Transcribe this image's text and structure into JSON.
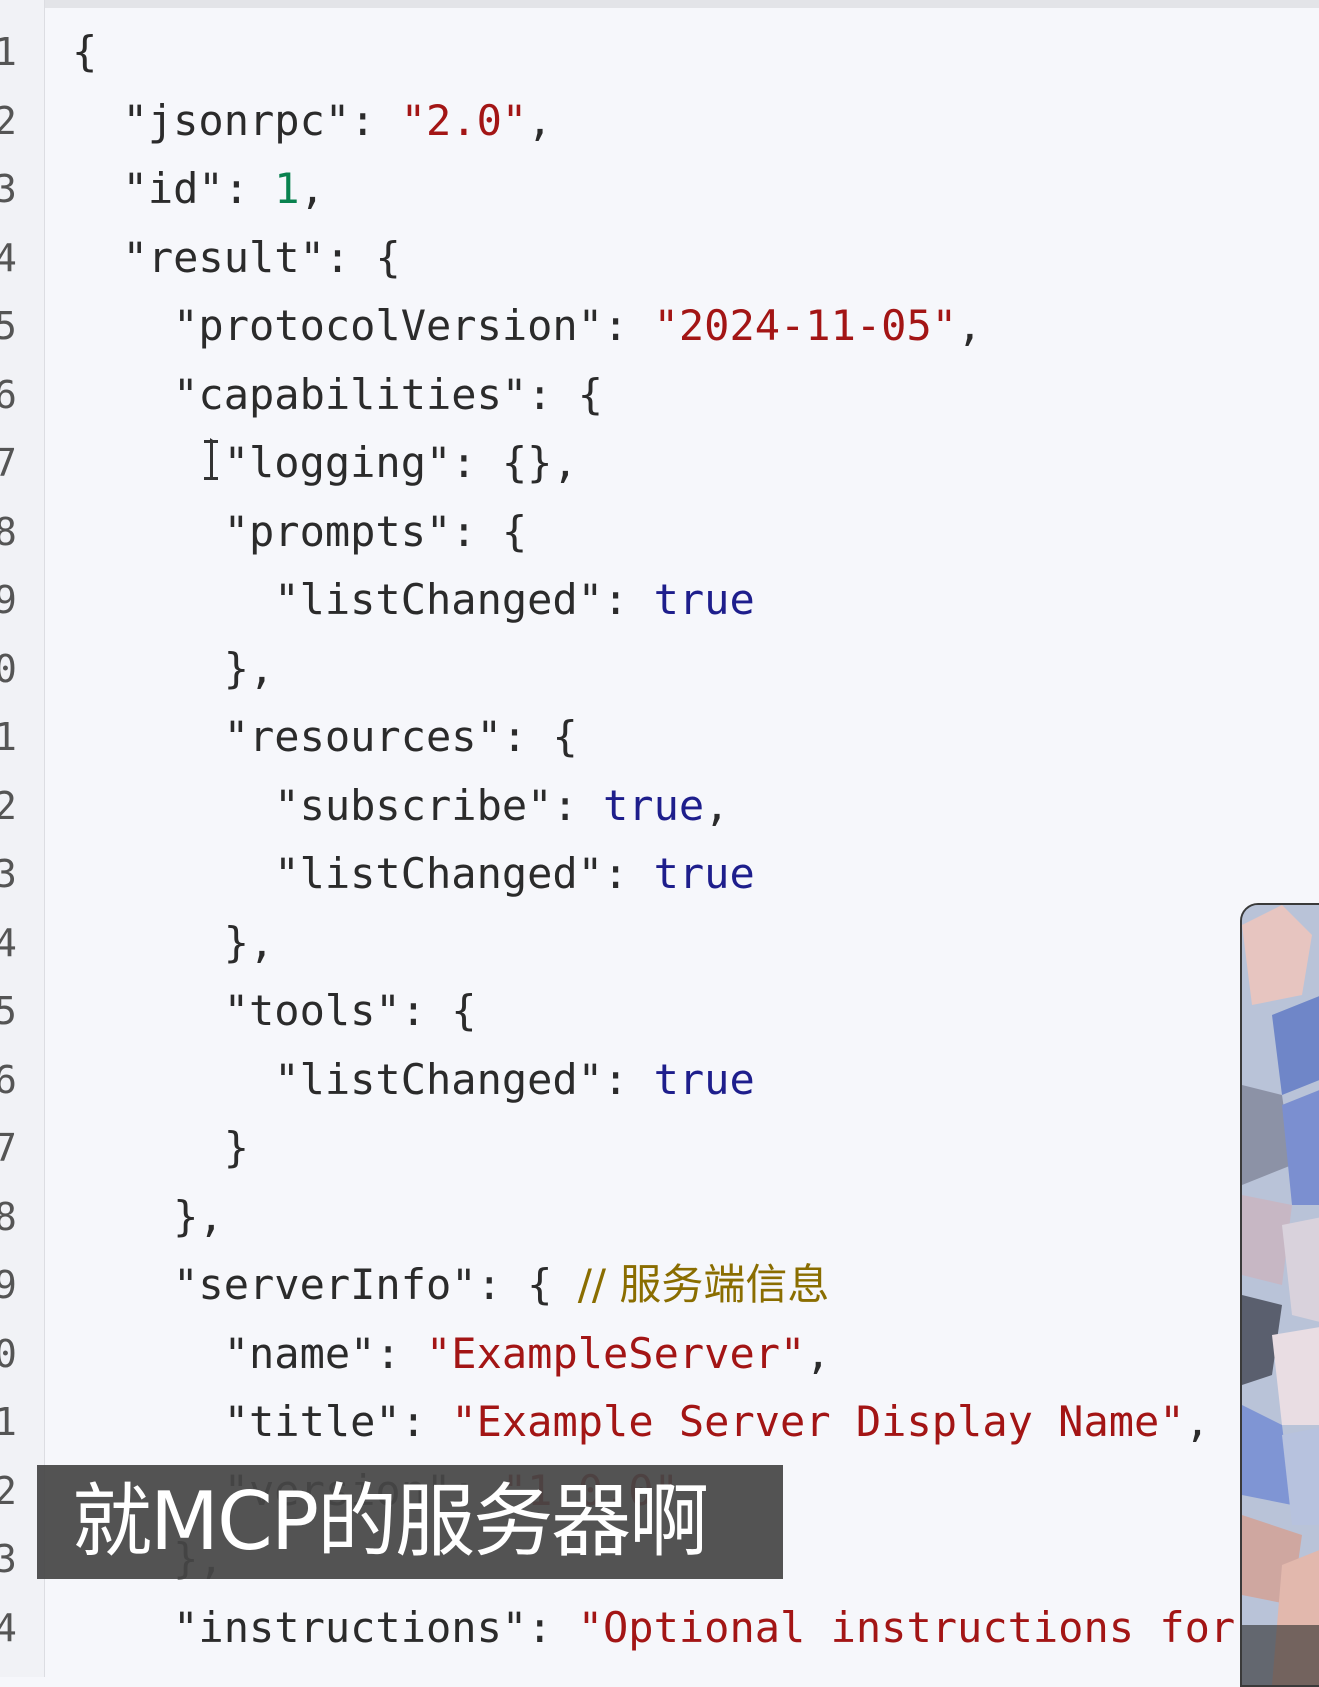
{
  "editor": {
    "line_numbers": [
      "1",
      "2",
      "3",
      "4",
      "5",
      "6",
      "7",
      "8",
      "9",
      "0",
      "1",
      "2",
      "3",
      "4",
      "5",
      "6",
      "7",
      "8",
      "9",
      "0",
      "1",
      "2",
      "3",
      "4"
    ],
    "lines": [
      [
        {
          "t": "{",
          "c": "punc"
        }
      ],
      [
        {
          "t": "  \"jsonrpc\"",
          "c": "key"
        },
        {
          "t": ": ",
          "c": "punc"
        },
        {
          "t": "\"2.0\"",
          "c": "str"
        },
        {
          "t": ",",
          "c": "punc"
        }
      ],
      [
        {
          "t": "  \"id\"",
          "c": "key"
        },
        {
          "t": ": ",
          "c": "punc"
        },
        {
          "t": "1",
          "c": "num"
        },
        {
          "t": ",",
          "c": "punc"
        }
      ],
      [
        {
          "t": "  \"result\"",
          "c": "key"
        },
        {
          "t": ": {",
          "c": "punc"
        }
      ],
      [
        {
          "t": "    \"protocolVersion\"",
          "c": "key"
        },
        {
          "t": ": ",
          "c": "punc"
        },
        {
          "t": "\"2024-11-05\"",
          "c": "str"
        },
        {
          "t": ",",
          "c": "punc"
        }
      ],
      [
        {
          "t": "    \"capabilities\"",
          "c": "key"
        },
        {
          "t": ": {",
          "c": "punc"
        }
      ],
      [
        {
          "t": "      \"logging\"",
          "c": "key"
        },
        {
          "t": ": {},",
          "c": "punc"
        }
      ],
      [
        {
          "t": "      \"prompts\"",
          "c": "key"
        },
        {
          "t": ": {",
          "c": "punc"
        }
      ],
      [
        {
          "t": "        \"listChanged\"",
          "c": "key"
        },
        {
          "t": ": ",
          "c": "punc"
        },
        {
          "t": "true",
          "c": "bool"
        }
      ],
      [
        {
          "t": "      },",
          "c": "punc"
        }
      ],
      [
        {
          "t": "      \"resources\"",
          "c": "key"
        },
        {
          "t": ": {",
          "c": "punc"
        }
      ],
      [
        {
          "t": "        \"subscribe\"",
          "c": "key"
        },
        {
          "t": ": ",
          "c": "punc"
        },
        {
          "t": "true",
          "c": "bool"
        },
        {
          "t": ",",
          "c": "punc"
        }
      ],
      [
        {
          "t": "        \"listChanged\"",
          "c": "key"
        },
        {
          "t": ": ",
          "c": "punc"
        },
        {
          "t": "true",
          "c": "bool"
        }
      ],
      [
        {
          "t": "      },",
          "c": "punc"
        }
      ],
      [
        {
          "t": "      \"tools\"",
          "c": "key"
        },
        {
          "t": ": {",
          "c": "punc"
        }
      ],
      [
        {
          "t": "        \"listChanged\"",
          "c": "key"
        },
        {
          "t": ": ",
          "c": "punc"
        },
        {
          "t": "true",
          "c": "bool"
        }
      ],
      [
        {
          "t": "      }",
          "c": "punc"
        }
      ],
      [
        {
          "t": "    },",
          "c": "punc"
        }
      ],
      [
        {
          "t": "    \"serverInfo\"",
          "c": "key"
        },
        {
          "t": ": { ",
          "c": "punc"
        },
        {
          "t": "// 服务端信息",
          "c": "comment"
        }
      ],
      [
        {
          "t": "      \"name\"",
          "c": "key"
        },
        {
          "t": ": ",
          "c": "punc"
        },
        {
          "t": "\"ExampleServer\"",
          "c": "str"
        },
        {
          "t": ",",
          "c": "punc"
        }
      ],
      [
        {
          "t": "      \"title\"",
          "c": "key"
        },
        {
          "t": ": ",
          "c": "punc"
        },
        {
          "t": "\"Example Server Display Name\"",
          "c": "str"
        },
        {
          "t": ",",
          "c": "punc"
        }
      ],
      [
        {
          "t": "      \"version\"",
          "c": "key"
        },
        {
          "t": ": ",
          "c": "punc"
        },
        {
          "t": "\"1.0.0\"",
          "c": "str"
        }
      ],
      [
        {
          "t": "    },",
          "c": "punc"
        }
      ],
      [
        {
          "t": "    \"instructions\"",
          "c": "key"
        },
        {
          "t": ": ",
          "c": "punc"
        },
        {
          "t": "\"Optional instructions for",
          "c": "str"
        }
      ]
    ]
  },
  "subtitle": "就MCP的服务器啊",
  "colors": {
    "background": "#f6f7fb",
    "string": "#a31515",
    "number": "#09824f",
    "boolean": "#1e1e8c",
    "comment": "#8a6d00"
  }
}
